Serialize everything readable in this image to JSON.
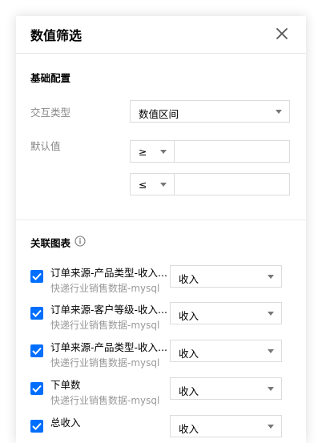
{
  "dialog": {
    "title": "数值筛选",
    "close_icon": "close-icon"
  },
  "basic": {
    "section_title": "基础配置",
    "interaction_type": {
      "label": "交互类型",
      "value": "数值区间"
    },
    "default_value": {
      "label": "默认值",
      "min_operator": "≥",
      "min_value": "",
      "max_operator": "≤",
      "max_value": ""
    }
  },
  "related": {
    "section_title": "关联图表",
    "info_icon": "info-icon",
    "charts": [
      {
        "checked": true,
        "title": "订单来源-产品类型-收入...",
        "source": "快递行业销售数据-mysql",
        "field": "收入"
      },
      {
        "checked": true,
        "title": "订单来源-客户等级-收入...",
        "source": "快递行业销售数据-mysql",
        "field": "收入"
      },
      {
        "checked": true,
        "title": "订单来源-产品类型-收入...",
        "source": "快递行业销售数据-mysql",
        "field": "收入"
      },
      {
        "checked": true,
        "title": "下单数",
        "source": "快递行业销售数据-mysql",
        "field": "收入"
      },
      {
        "checked": true,
        "title": "总收入",
        "source": "",
        "field": "收入"
      }
    ]
  },
  "colors": {
    "accent": "#006eff",
    "label_gray": "#888888",
    "border": "#dcdcdc"
  }
}
